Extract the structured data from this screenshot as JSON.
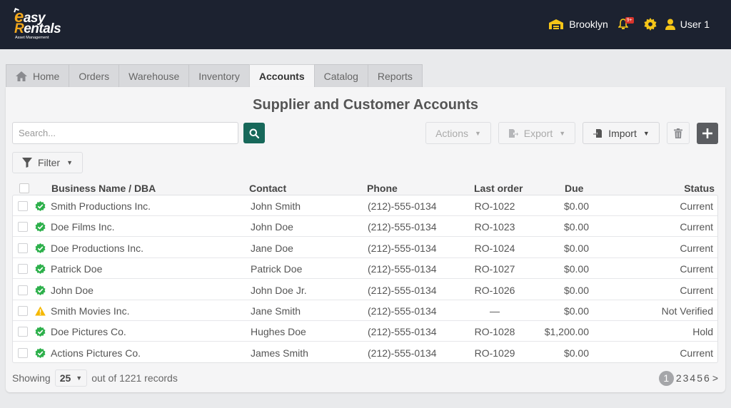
{
  "brand": {
    "name_part1": "asy",
    "name_part2": "entals",
    "letter_e": "e",
    "letter_r": "R",
    "tagline": "Asset Management",
    "accent": "#f2a81d"
  },
  "header": {
    "location": "Brooklyn",
    "notifications_badge": "9+",
    "user": "User 1"
  },
  "tabs": [
    {
      "label": "Home"
    },
    {
      "label": "Orders"
    },
    {
      "label": "Warehouse"
    },
    {
      "label": "Inventory"
    },
    {
      "label": "Accounts",
      "active": true
    },
    {
      "label": "Catalog"
    },
    {
      "label": "Reports"
    }
  ],
  "page": {
    "title": "Supplier and Customer Accounts"
  },
  "search": {
    "placeholder": "Search..."
  },
  "toolbar": {
    "actions": "Actions",
    "export": "Export",
    "import": "Import",
    "filter": "Filter"
  },
  "table": {
    "columns": {
      "business": "Business Name / DBA",
      "contact": "Contact",
      "phone": "Phone",
      "last_order": "Last order",
      "due": "Due",
      "status": "Status"
    },
    "rows": [
      {
        "business": "Smith Productions Inc.",
        "contact": "John Smith",
        "phone": "(212)-555-0134",
        "last_order": "RO-1022",
        "due": "$0.00",
        "status": "Current",
        "icon": "verified"
      },
      {
        "business": "Doe Films Inc.",
        "contact": "John Doe",
        "phone": "(212)-555-0134",
        "last_order": "RO-1023",
        "due": "$0.00",
        "status": "Current",
        "icon": "verified"
      },
      {
        "business": "Doe Productions Inc.",
        "contact": "Jane Doe",
        "phone": "(212)-555-0134",
        "last_order": "RO-1024",
        "due": "$0.00",
        "status": "Current",
        "icon": "verified"
      },
      {
        "business": "Patrick Doe",
        "contact": "Patrick Doe",
        "phone": "(212)-555-0134",
        "last_order": "RO-1027",
        "due": "$0.00",
        "status": "Current",
        "icon": "verified"
      },
      {
        "business": "John Doe",
        "contact": "John Doe Jr.",
        "phone": "(212)-555-0134",
        "last_order": "RO-1026",
        "due": "$0.00",
        "status": "Current",
        "icon": "verified"
      },
      {
        "business": "Smith Movies Inc.",
        "contact": "Jane Smith",
        "phone": "(212)-555-0134",
        "last_order": "—",
        "due": "$0.00",
        "status": "Not Verified",
        "icon": "warning"
      },
      {
        "business": "Doe Pictures Co.",
        "contact": "Hughes Doe",
        "phone": "(212)-555-0134",
        "last_order": "RO-1028",
        "due": "$1,200.00",
        "status": "Hold",
        "icon": "verified"
      },
      {
        "business": "Actions Pictures Co.",
        "contact": "James Smith",
        "phone": "(212)-555-0134",
        "last_order": "RO-1029",
        "due": "$0.00",
        "status": "Current",
        "icon": "verified"
      }
    ]
  },
  "footer": {
    "showing_label": "Showing",
    "page_size": "25",
    "records_text": "out of 1221 records",
    "pages": [
      "1",
      "2",
      "3",
      "4",
      "5",
      "6"
    ],
    "next": ">",
    "current_page": "1"
  },
  "colors": {
    "topbar": "#1c2230",
    "primary": "#17685a",
    "verified_green": "#2db04b",
    "warning_yellow": "#f5b800",
    "badge_red": "#d9342b"
  }
}
